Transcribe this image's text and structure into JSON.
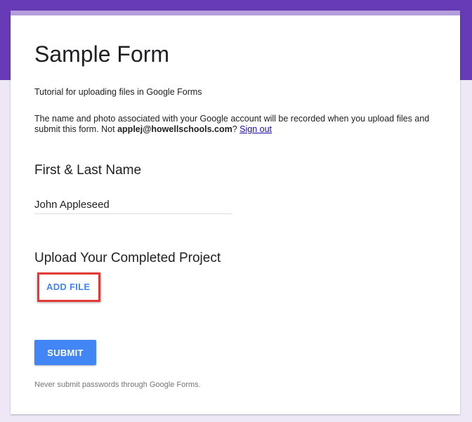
{
  "colors": {
    "banner": "#673ab7",
    "card_top": "#b39ddb",
    "background": "#ede7f6",
    "primary_button": "#4285f4",
    "highlight_box": "#e53935",
    "link": "#1a0dab"
  },
  "form": {
    "title": "Sample Form",
    "description": "Tutorial for uploading files in Google Forms",
    "notice_text": "The name and photo associated with your Google account will be recorded when you upload files and submit this form. Not ",
    "account_email": "applej@howellschools.com",
    "notice_suffix": "? ",
    "sign_out_label": "Sign out"
  },
  "questions": [
    {
      "label": "First & Last Name",
      "value": "John Appleseed"
    },
    {
      "label": "Upload Your Completed Project",
      "button_label": "ADD FILE"
    }
  ],
  "submit_label": "SUBMIT",
  "footer_text": "Never submit passwords through Google Forms."
}
